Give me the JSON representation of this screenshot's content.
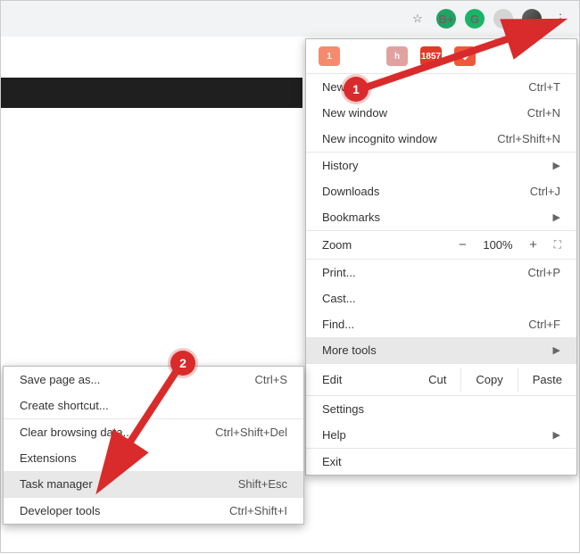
{
  "toolbar": {
    "star_icon": "star-icon",
    "ext_b": "B+",
    "ext_g": "G"
  },
  "extensions": {
    "ghostery_badge": "1",
    "gmail_badge": "1857"
  },
  "menu": {
    "new_tab": "New Tab",
    "new_tab_k": "Ctrl+T",
    "new_window": "New window",
    "new_window_k": "Ctrl+N",
    "new_incognito": "New incognito window",
    "new_incognito_k": "Ctrl+Shift+N",
    "history": "History",
    "downloads": "Downloads",
    "downloads_k": "Ctrl+J",
    "bookmarks": "Bookmarks",
    "zoom_lbl": "Zoom",
    "zoom_val": "100%",
    "print": "Print...",
    "print_k": "Ctrl+P",
    "cast": "Cast...",
    "find": "Find...",
    "find_k": "Ctrl+F",
    "more_tools": "More tools",
    "edit_lbl": "Edit",
    "cut": "Cut",
    "copy": "Copy",
    "paste": "Paste",
    "settings": "Settings",
    "help": "Help",
    "exit": "Exit"
  },
  "submenu": {
    "save_as": "Save page as...",
    "save_as_k": "Ctrl+S",
    "create_shortcut": "Create shortcut...",
    "clear_data": "Clear browsing data...",
    "clear_data_k": "Ctrl+Shift+Del",
    "extensions": "Extensions",
    "task_manager": "Task manager",
    "task_manager_k": "Shift+Esc",
    "devtools": "Developer tools",
    "devtools_k": "Ctrl+Shift+I"
  },
  "annotations": {
    "step1": "1",
    "step2": "2"
  }
}
